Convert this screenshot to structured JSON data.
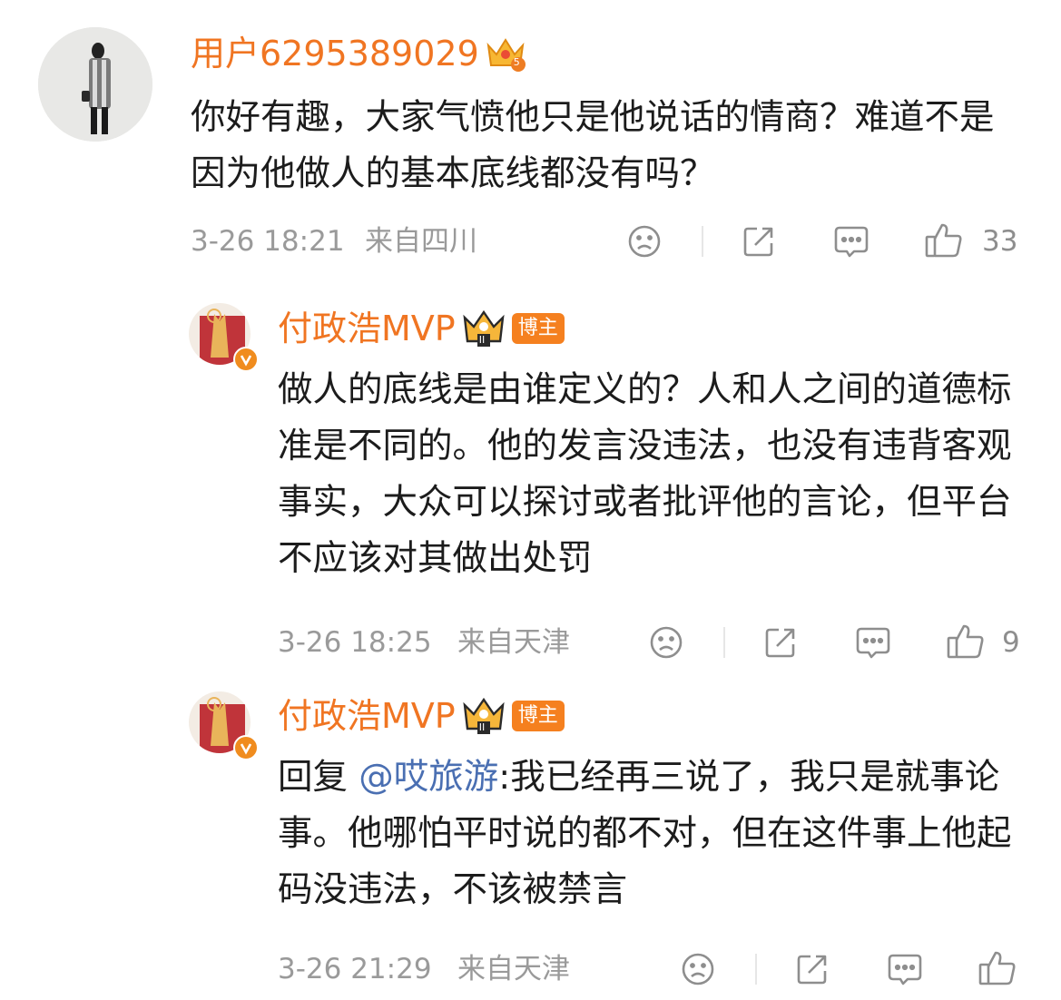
{
  "colors": {
    "name_orange": "#f07522",
    "meta_gray": "#9a9a9a",
    "mention_blue": "#4a6fb2",
    "badge_orange": "#f5801f",
    "verified_orange": "#f08c1e"
  },
  "icons": {
    "dislike": "sad-face-icon",
    "share": "share-icon",
    "comment": "comment-icon",
    "like": "thumbs-up-icon",
    "vip": "crown-icon"
  },
  "comments": [
    {
      "author": "用户6295389029",
      "vip_level": "5",
      "text": "你好有趣，大家气愤他只是他说话的情商？难道不是因为他做人的基本底线都没有吗？",
      "time": "3-26 18:21",
      "location": "来自四川",
      "likes": "33"
    },
    {
      "author": "付政浩MVP",
      "vip_level": "II",
      "badge": "博主",
      "text": "做人的底线是由谁定义的？人和人之间的道德标准是不同的。他的发言没违法，也没有违背客观事实，大众可以探讨或者批评他的言论，但平台不应该对其做出处罚",
      "time": "3-26 18:25",
      "location": "来自天津",
      "likes": "9"
    },
    {
      "author": "付政浩MVP",
      "vip_level": "II",
      "badge": "博主",
      "reply_prefix": "回复",
      "mention": "@哎旅游",
      "text": ":我已经再三说了，我只是就事论事。他哪怕平时说的都不对，但在这件事上他起码没违法，不该被禁言",
      "time": "3-26 21:29",
      "location": "来自天津",
      "likes": ""
    }
  ]
}
